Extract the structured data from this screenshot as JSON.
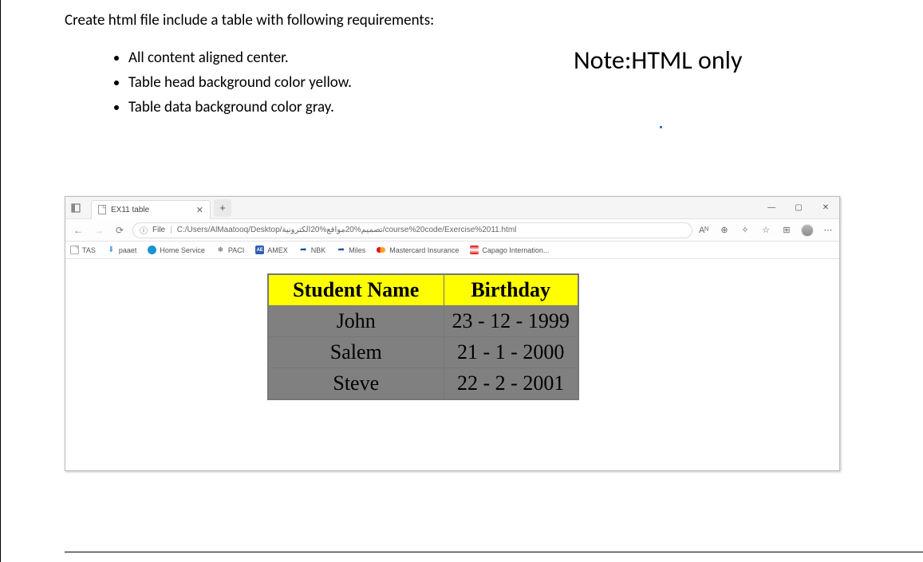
{
  "instruction": {
    "title": "Create html file include a table with following requirements:",
    "items": [
      "All content aligned center.",
      "Table head background color yellow.",
      "Table data background color gray."
    ],
    "note": "Note:HTML only"
  },
  "browser": {
    "tab_title": "EX11 table",
    "new_tab_label": "+",
    "win": {
      "min": "—",
      "max": "▢",
      "close": "✕"
    },
    "nav": {
      "back": "←",
      "forward": "→",
      "refresh": "⟳"
    },
    "url": {
      "info_icon": "ⓘ",
      "prefix": "File",
      "path": "C:/Users/AlMaatooq/Desktop/تصميم%20مواقع%20الكترونية/course%20code/Exercise%2011.html"
    },
    "right": {
      "reader": "Aᴺ",
      "zoom": "⊕",
      "shop": "✧",
      "fav": "☆",
      "collections": "⊞",
      "menu": "⋯"
    },
    "bookmarks": [
      {
        "icon": "page",
        "label": "TAS"
      },
      {
        "icon": "dl",
        "label": "paaet"
      },
      {
        "icon": "circle",
        "label": "Home Service"
      },
      {
        "icon": "snow",
        "label": "PACI"
      },
      {
        "icon": "amex",
        "label": "AMEX"
      },
      {
        "icon": "ren",
        "label": "NBK"
      },
      {
        "icon": "ren",
        "label": "Miles"
      },
      {
        "icon": "mc",
        "label": "Mastercard Insurance"
      },
      {
        "icon": "flag",
        "label": "Capago Internation..."
      }
    ]
  },
  "table": {
    "headers": [
      "Student Name",
      "Birthday"
    ],
    "rows": [
      [
        "John",
        "23 - 12 - 1999"
      ],
      [
        "Salem",
        "21 - 1 - 2000"
      ],
      [
        "Steve",
        "22 - 2 - 2001"
      ]
    ]
  }
}
